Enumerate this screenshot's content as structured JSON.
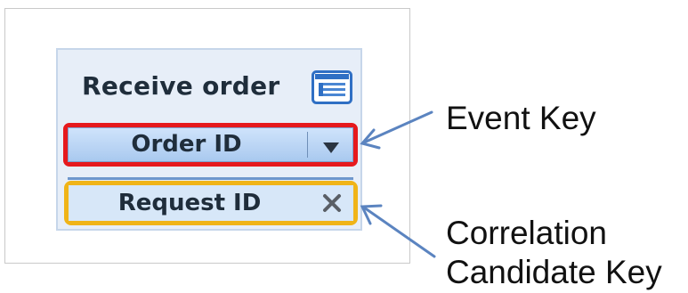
{
  "widget": {
    "title": "Receive order",
    "event_key_field": "Order ID",
    "candidate_key_field": "Request ID"
  },
  "annotations": {
    "event_key": "Event Key",
    "candidate_key_line1": "Correlation",
    "candidate_key_line2": "Candidate Key"
  },
  "icons": {
    "title_icon": "table-icon",
    "dropdown": "dropdown-triangle-icon",
    "remove": "close-x-icon"
  },
  "colors": {
    "event_key_highlight": "#e6191d",
    "candidate_key_highlight": "#f0b418",
    "arrow": "#5b84c0"
  }
}
